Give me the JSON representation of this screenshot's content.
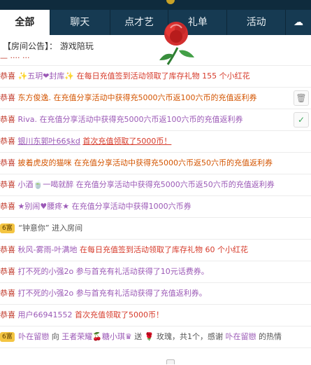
{
  "tabs": [
    {
      "label": "全部",
      "active": true
    },
    {
      "label": "聊天",
      "active": false
    },
    {
      "label": "点才艺",
      "active": false
    },
    {
      "label": "礼单",
      "active": false
    },
    {
      "label": "活动",
      "active": false
    }
  ],
  "notice": {
    "label": "【房间公告】：",
    "text": "游戏陪玩"
  },
  "messages": [
    {
      "pre": "恭喜",
      "a": "✨五玥❤封库✨",
      "b": "在每日充值签到活动领取了库存礼物 155 个小红花"
    },
    {
      "pre": "恭喜",
      "a": "东方俊逸.",
      "b": "在充值分享活动中获得充5000六币返100六币的充值返利券"
    },
    {
      "pre": "恭喜",
      "a": "Riva.",
      "b": "在充值分享活动中获得充5000六币返100六币的充值返利券"
    },
    {
      "pre": "恭喜",
      "a": "银川东郭叶66$kd",
      "b": "首次充值领取了5000币！"
    },
    {
      "pre": "恭喜",
      "a": "披着虎皮的猫咪",
      "b": "在充值分享活动中获得充5000六币返50六币的充值返利券"
    },
    {
      "pre": "恭喜",
      "a": "小酒🍵一喝就醉",
      "b": "在充值分享活动中获得充5000六币返50六币的充值返利券"
    },
    {
      "pre": "恭喜",
      "a": "★别闹♥腰疼★",
      "b": "在充值分享活动中获得1000六币券"
    },
    {
      "badge": "6富",
      "a": "“钟意你”",
      "b": "进入房间"
    },
    {
      "pre": "恭喜",
      "a": "秋风-雾雨-叶满地",
      "b": "在每日充值签到活动领取了库存礼物 60 个小红花"
    },
    {
      "pre": "恭喜",
      "a": "打不死的小强2o",
      "b": "参与首充有礼活动获得了10元话费券。"
    },
    {
      "pre": "恭喜",
      "a": "打不死的小强2o",
      "b": "参与首充有礼活动获得了充值返利券。"
    },
    {
      "pre": "恭喜",
      "a": "用户66941552",
      "b": "首次充值领取了5000币！"
    },
    {
      "badge": "6富",
      "a": "卟在留戀",
      "b": "向",
      "c": "王者荣耀🍒糖小琪♛",
      "d": "送",
      "e": "玫瑰，共1个，感谢",
      "f": "卟在留戀",
      "g": "的热情"
    }
  ],
  "side_icons": {
    "delete": "trash-icon",
    "confirm": "check-icon"
  },
  "colors": {
    "tabbar": "#163a52",
    "highlight": "#d63a2a",
    "accent": "#d35400"
  }
}
